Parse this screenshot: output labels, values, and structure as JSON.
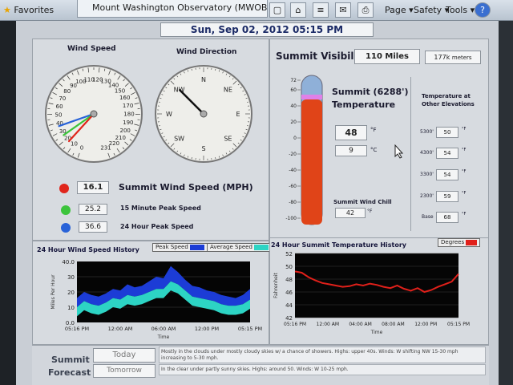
{
  "browser": {
    "favorites": "Favorites",
    "tab_title": "Mount Washington Observatory (MWOBS) –",
    "menu_page": "Page ▾",
    "menu_safety": "Safety ▾",
    "menu_tools": "Tools ▾",
    "help": "?"
  },
  "header": {
    "datetime": "Sun, Sep 02, 2012 05:15 PM"
  },
  "wind_speed_gauge": {
    "title": "Wind Speed",
    "ticks": [
      "120",
      "130",
      "140",
      "110",
      "100",
      "90",
      "80",
      "70",
      "60",
      "50",
      "40",
      "30",
      "20",
      "10",
      "0",
      "150",
      "160",
      "170",
      "180",
      "190",
      "200",
      "210",
      "220",
      "231"
    ],
    "needles": [
      {
        "name": "current",
        "value": 16.1,
        "color": "#e0261c"
      },
      {
        "name": "15min",
        "value": 25.2,
        "color": "#3cc43c"
      },
      {
        "name": "24hr",
        "value": 36.6,
        "color": "#2862d8"
      }
    ]
  },
  "wind_direction_gauge": {
    "title": "Wind Direction",
    "labels": [
      "N",
      "NE",
      "E",
      "SE",
      "S",
      "SW",
      "W",
      "NW"
    ],
    "direction_deg": 315
  },
  "wind_readings": {
    "summit_value": "16.1",
    "summit_label": "Summit Wind Speed (MPH)",
    "peak15_value": "25.2",
    "peak15_label": "15 Minute Peak Speed",
    "peak24_value": "36.6",
    "peak24_label": "24 Hour Peak Speed",
    "colors": {
      "summit": "#e0261c",
      "peak15": "#3cc43c",
      "peak24": "#2862d8"
    }
  },
  "visibility": {
    "label": "Summit Visibility",
    "miles": "110 Miles",
    "meters_value": "177k",
    "meters_unit": "meters"
  },
  "temperature": {
    "title_line1": "Summit (6288')",
    "title_line2": "Temperature",
    "fahrenheit": "48",
    "f_unit": "°F",
    "celsius": "9",
    "c_unit": "°C",
    "scale": [
      "72",
      "60",
      "40",
      "20",
      "0",
      "-20",
      "-40",
      "-60",
      "-80",
      "-100"
    ],
    "wind_chill_label": "Summit Wind Chill",
    "wind_chill": "42",
    "wc_unit": "°F",
    "thermo_value": 48
  },
  "elevations": {
    "title_line1": "Temperature at",
    "title_line2": "Other Elevations",
    "rows": [
      {
        "elev": "5300'",
        "temp": "50"
      },
      {
        "elev": "4300'",
        "temp": "54"
      },
      {
        "elev": "3300'",
        "temp": "54"
      },
      {
        "elev": "2300'",
        "temp": "59"
      },
      {
        "elev": "Base",
        "temp": "68"
      }
    ],
    "unit": "°F"
  },
  "forecast": {
    "label_line1": "Summit",
    "label_line2": "Forecast",
    "today_tab": "Today",
    "tomorrow_tab": "Tomorrow",
    "today_text": "Mostly in the clouds under mostly cloudy skies w/ a chance of showers. Highs: upper 40s. Winds: W shifting NW 15-30 mph increasing to 5-30 mph.",
    "tomorrow_text": "In the clear under partly sunny skies. Highs: around 50. Winds: W 10-25 mph."
  },
  "wind_chart": {
    "title": "24 Hour Wind Speed History",
    "legend_peak": "Peak Speed",
    "legend_avg": "Average Speed",
    "xlabel": "Time",
    "ylabel": "Miles Per Hour",
    "xticks": [
      "05:16 PM",
      "12:00 AM",
      "06:00 AM",
      "12:00 PM",
      "05:15 PM"
    ]
  },
  "temp_chart": {
    "title": "24 Hour Summit Temperature History",
    "legend": "Degrees",
    "xlabel": "Time",
    "ylabel": "Fahrenheit",
    "xticks": [
      "05:16 PM",
      "12:00 AM",
      "04:00 AM",
      "08:00 AM",
      "12:00 PM",
      "05:15 PM"
    ]
  },
  "chart_data": [
    {
      "type": "area",
      "title": "24 Hour Wind Speed History",
      "xlabel": "Time",
      "ylabel": "Miles Per Hour",
      "ylim": [
        0,
        40
      ],
      "yticks": [
        "40.0",
        "30",
        "20",
        "10",
        "0.0"
      ],
      "x": [
        0,
        1,
        2,
        3,
        4,
        5,
        6,
        7,
        8,
        9,
        10,
        11,
        12,
        13,
        14,
        15,
        16,
        17,
        18,
        19,
        20,
        21,
        22,
        23,
        24
      ],
      "series": [
        {
          "name": "Peak Speed",
          "color": "#1c3cd6",
          "values": [
            16,
            20,
            18,
            17,
            19,
            22,
            21,
            25,
            23,
            24,
            27,
            30,
            29,
            37,
            33,
            28,
            24,
            23,
            21,
            20,
            18,
            17,
            16,
            18,
            22
          ]
        },
        {
          "name": "Average Speed",
          "color": "#2dd4c4",
          "values": [
            10,
            14,
            12,
            11,
            13,
            16,
            15,
            18,
            17,
            18,
            20,
            22,
            22,
            27,
            25,
            21,
            17,
            16,
            15,
            14,
            12,
            11,
            11,
            12,
            15
          ]
        }
      ]
    },
    {
      "type": "line",
      "title": "24 Hour Summit Temperature History",
      "xlabel": "Time",
      "ylabel": "Fahrenheit",
      "ylim": [
        42,
        52
      ],
      "yticks": [
        "52",
        "50",
        "48",
        "46",
        "44",
        "42"
      ],
      "x": [
        0,
        1,
        2,
        3,
        4,
        5,
        6,
        7,
        8,
        9,
        10,
        11,
        12,
        13,
        14,
        15,
        16,
        17,
        18,
        19,
        20,
        21,
        22,
        23,
        24
      ],
      "series": [
        {
          "name": "Temperature",
          "color": "#e0201a",
          "values": [
            49.2,
            49.0,
            48.3,
            47.8,
            47.4,
            47.2,
            47.0,
            46.8,
            46.9,
            47.2,
            47.0,
            47.3,
            47.1,
            46.8,
            46.6,
            47.0,
            46.5,
            46.2,
            46.6,
            46.0,
            46.3,
            46.8,
            47.2,
            47.6,
            48.8
          ]
        }
      ]
    }
  ]
}
